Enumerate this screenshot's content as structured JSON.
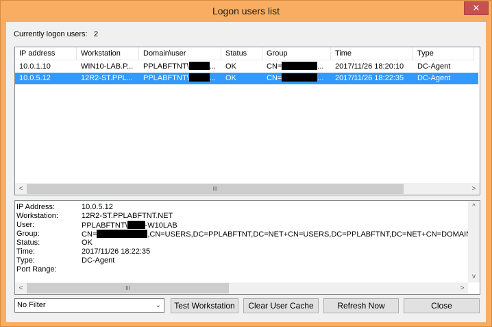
{
  "window": {
    "title": "Logon users list",
    "close_glyph": "✕"
  },
  "summary": {
    "label": "Currently logon users:",
    "count": "2"
  },
  "table": {
    "columns": [
      "IP address",
      "Workstation",
      "Domain\\user",
      "Status",
      "Group",
      "Time",
      "Type"
    ],
    "rows": [
      {
        "ip": "10.0.1.10",
        "workstation": "WIN10-LAB.P...",
        "domain_user_prefix": "PPLABFTNT\\",
        "domain_user_suffix": "...",
        "status": "OK",
        "group_prefix": "CN=",
        "group_suffix": "...",
        "time": "2017/11/26 18:20:10",
        "type": "DC-Agent",
        "selected": false
      },
      {
        "ip": "10.0.5.12",
        "workstation": "12R2-ST.PPL...",
        "domain_user_prefix": "PPLABFTNT\\",
        "domain_user_suffix": "...",
        "status": "OK",
        "group_prefix": "CN=",
        "group_suffix": "...",
        "time": "2017/11/26 18:22:35",
        "type": "DC-Agent",
        "selected": true
      }
    ]
  },
  "details": {
    "ip_label": "IP Address:",
    "ip_value": "10.0.5.12",
    "ws_label": "Workstation:",
    "ws_value": "12R2-ST.PPLABFTNT.NET",
    "user_label": "User:",
    "user_prefix": "PPLABFTNT\\",
    "user_suffix": "-W10LAB",
    "group_label": "Group:",
    "group_prefix": "CN=",
    "group_suffix": ",CN=USERS,DC=PPLABFTNT,DC=NET+CN=USERS,DC=PPLABFTNT,DC=NET+CN=DOMAIN U",
    "status_label": "Status:",
    "status_value": "OK",
    "time_label": "Time:",
    "time_value": "2017/11/26 18:22:35",
    "type_label": "Type:",
    "type_value": "DC-Agent",
    "port_label": "Port Range:",
    "port_value": ""
  },
  "scroll": {
    "left": "<",
    "right": ">",
    "up": "^",
    "down": "v",
    "grip": "III"
  },
  "filter": {
    "selected": "No Filter"
  },
  "buttons": {
    "test": "Test Workstation",
    "clear": "Clear User Cache",
    "refresh": "Refresh Now",
    "close": "Close"
  }
}
